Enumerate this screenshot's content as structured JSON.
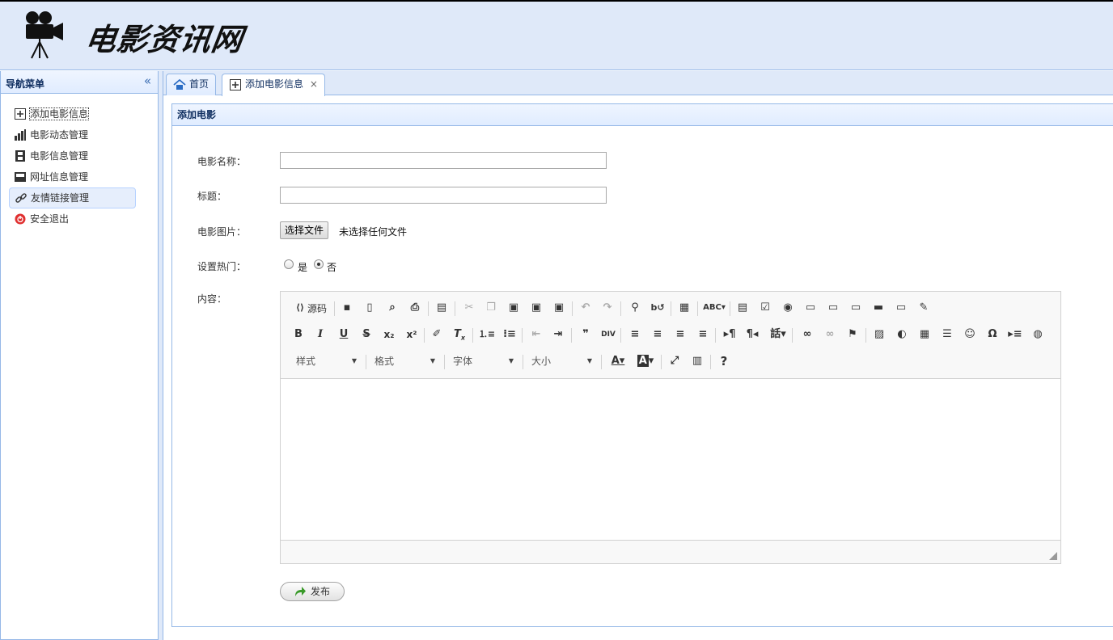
{
  "header": {
    "logo_text": "电影资讯网"
  },
  "west": {
    "title": "导航菜单",
    "items": [
      {
        "label": "添加电影信息"
      },
      {
        "label": "电影动态管理"
      },
      {
        "label": "电影信息管理"
      },
      {
        "label": "网址信息管理"
      },
      {
        "label": "友情链接管理"
      },
      {
        "label": "安全退出"
      }
    ]
  },
  "tabs": [
    {
      "label": "首页"
    },
    {
      "label": "添加电影信息",
      "close": "×"
    }
  ],
  "panel": {
    "title": "添加电影",
    "fields": {
      "name_label": "电影名称：",
      "title_label": "标题：",
      "image_label": "电影图片：",
      "file_button": "选择文件",
      "file_status": "未选择任何文件",
      "hot_label": "设置热门：",
      "hot_yes": "是",
      "hot_no": "否",
      "content_label": "内容："
    },
    "editor": {
      "source_label": "源码",
      "combos": [
        "样式",
        "格式",
        "字体",
        "大小"
      ]
    },
    "publish_label": "发布"
  }
}
